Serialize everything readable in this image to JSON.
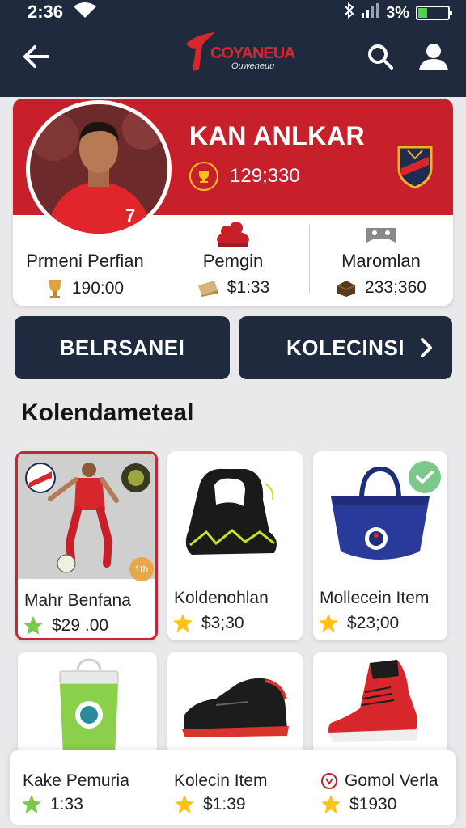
{
  "status_bar": {
    "time": "2:36",
    "battery": "3%",
    "battery_level": 0.3
  },
  "header": {
    "logo_title": "COYANEUA",
    "logo_subtitle": "Ouweneuu",
    "icons": [
      "arrow-left-icon",
      "search-icon",
      "user-icon"
    ]
  },
  "profile": {
    "name": "KAN ANLKAR",
    "points": "129;330",
    "stats": [
      {
        "label": "Prmeni Perfian",
        "value": "190:00",
        "icon": "trophy-icon"
      },
      {
        "label": "Pemgin",
        "value": "$1:33",
        "icon": "ticket-icon"
      },
      {
        "label": "Maromlan",
        "value": "233;360",
        "icon": "box-icon"
      }
    ]
  },
  "actions": {
    "primary": "BELRSANEI",
    "secondary": "KOLECINSI"
  },
  "section": {
    "title": "Kolendameteal"
  },
  "items_row1": [
    {
      "name": "Mahr Benfana",
      "price": "$29 .00",
      "badge": "1th",
      "selected": true
    },
    {
      "name": "Koldenohlan",
      "price": "$3;30"
    },
    {
      "name": "Mollecein Item",
      "price": "$23;00",
      "owned": true
    }
  ],
  "items_row2": [
    {
      "name": "Kake Pemuria",
      "price": "1:33"
    },
    {
      "name": "Kolecin Item",
      "price": "$1:39"
    },
    {
      "name": "Gomol Verla",
      "price": "$1930"
    }
  ],
  "colors": {
    "navy": "#1f2a3f",
    "red": "#c8202a",
    "gold": "#ffc21a",
    "green_star": "#7cc84a"
  }
}
